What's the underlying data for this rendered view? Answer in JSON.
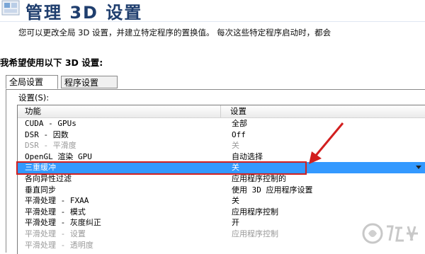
{
  "window": {
    "title": "管理 3D 设置",
    "description": "您可以更改全局 3D 设置，并建立特定程序的置换值。 每次这些特定程序启动时，都会"
  },
  "section": {
    "heading": "我希望使用以下 3D 设置:"
  },
  "tabs": [
    {
      "label": "全局设置",
      "active": true
    },
    {
      "label": "程序设置",
      "active": false
    }
  ],
  "settings": {
    "label": "设置(S):",
    "columns": {
      "feature": "功能",
      "setting": "设置"
    },
    "rows": [
      {
        "feature": "CUDA - GPUs",
        "value": "全部",
        "state": "normal"
      },
      {
        "feature": "DSR - 因数",
        "value": "Off",
        "state": "normal"
      },
      {
        "feature": "DSR - 平滑度",
        "value": "关",
        "state": "disabled"
      },
      {
        "feature": "OpenGL 渲染 GPU",
        "value": "自动选择",
        "state": "normal"
      },
      {
        "feature": "三重缓冲",
        "value": "关",
        "state": "selected"
      },
      {
        "feature": "各向异性过滤",
        "value": "应用程序控制的",
        "state": "normal"
      },
      {
        "feature": "垂直同步",
        "value": "使用 3D 应用程序设置",
        "state": "normal"
      },
      {
        "feature": "平滑处理 - FXAA",
        "value": "关",
        "state": "normal"
      },
      {
        "feature": "平滑处理 - 模式",
        "value": "应用程序控制",
        "state": "normal"
      },
      {
        "feature": "平滑处理 - 灰度纠正",
        "value": "开",
        "state": "normal"
      },
      {
        "feature": "平滑处理 - 设置",
        "value": "应用程序控制",
        "state": "disabled"
      },
      {
        "feature": "平滑处理 - 透明度",
        "value": "",
        "state": "disabled"
      }
    ]
  },
  "annotations": {
    "highlight_color": "#d21f1f",
    "selection_color": "#3399ff"
  },
  "icons": {
    "app": "nvidia-3d-settings-icon",
    "watermark": "jiuyou-logo"
  }
}
